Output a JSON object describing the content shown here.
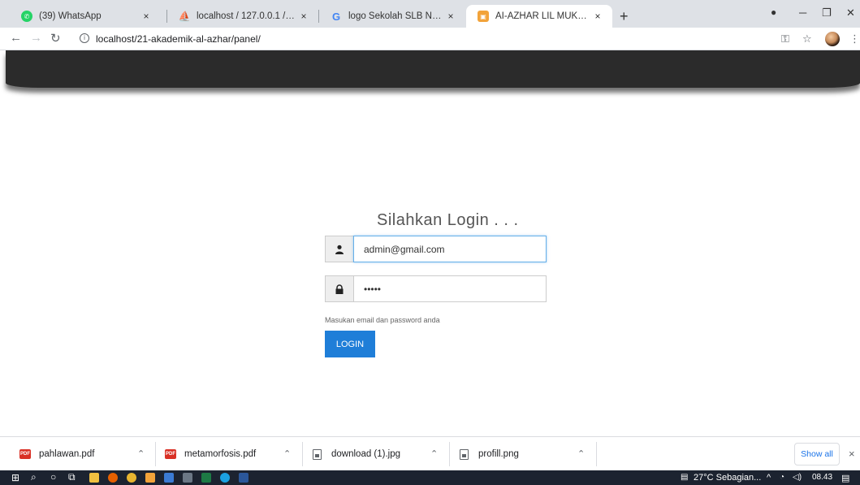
{
  "browser": {
    "tabs": [
      {
        "title": "(39) WhatsApp",
        "close": "×"
      },
      {
        "title": "localhost / 127.0.0.1 / db_akademik",
        "close": "×"
      },
      {
        "title": "logo Sekolah SLB Negeri Autis Su",
        "close": "×"
      },
      {
        "title": "AI-AZHAR LIL MUKHTARIN",
        "close": "×"
      }
    ],
    "new_tab": "+",
    "url": "localhost/21-akademik-al-azhar/panel/"
  },
  "login": {
    "title": "Silahkan Login . . .",
    "email_value": "admin@gmail.com",
    "password_value": "•••••",
    "help_text": "Masukan email dan password anda",
    "button_label": "LOGIN"
  },
  "downloads": {
    "items": [
      {
        "name": "pahlawan.pdf",
        "type": "pdf"
      },
      {
        "name": "metamorfosis.pdf",
        "type": "pdf"
      },
      {
        "name": "download (1).jpg",
        "type": "image"
      },
      {
        "name": "profill.png",
        "type": "image"
      }
    ],
    "show_all": "Show all",
    "close": "×"
  },
  "taskbar": {
    "weather": "27°C  Sebagian...",
    "time": "08.43"
  },
  "colors": {
    "header_dark": "#2b2b2b",
    "login_button": "#1f7ed8",
    "tab_strip": "#dee1e6"
  }
}
